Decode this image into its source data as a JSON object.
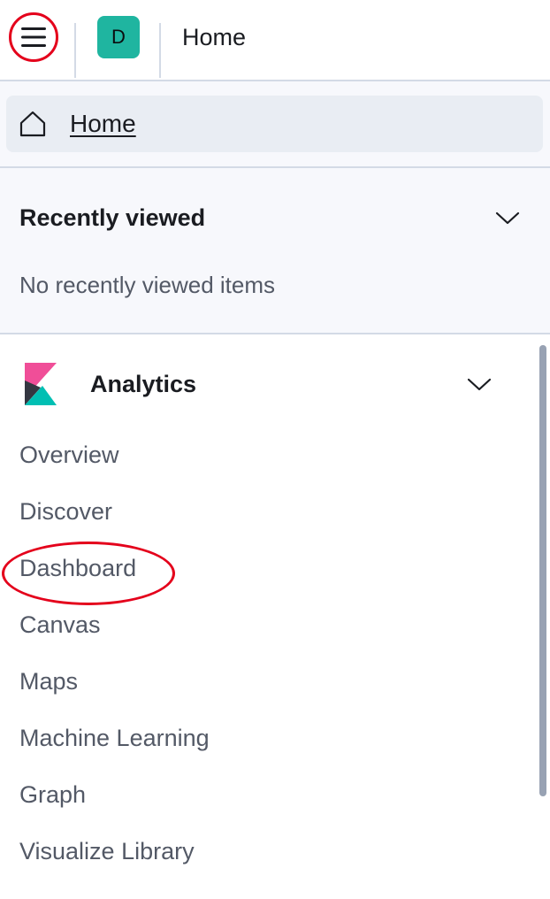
{
  "header": {
    "menu_icon": "hamburger-menu-icon",
    "space_avatar_letter": "D",
    "space_avatar_color": "#1fb5a0",
    "title": "Home"
  },
  "home_link": {
    "icon": "home-icon",
    "label": "Home"
  },
  "recently_viewed": {
    "title": "Recently viewed",
    "chevron_icon": "chevron-down-icon",
    "empty_message": "No recently viewed items"
  },
  "analytics": {
    "logo_icon": "kibana-logo-icon",
    "title": "Analytics",
    "chevron_icon": "chevron-down-icon",
    "items": [
      {
        "label": "Overview"
      },
      {
        "label": "Discover"
      },
      {
        "label": "Dashboard"
      },
      {
        "label": "Canvas"
      },
      {
        "label": "Maps"
      },
      {
        "label": "Machine Learning"
      },
      {
        "label": "Graph"
      },
      {
        "label": "Visualize Library"
      }
    ]
  },
  "colors": {
    "annotation_red": "#e4001b",
    "panel_background": "#f7f8fc",
    "border": "#d3dae6",
    "logo_pink": "#f04e98",
    "logo_teal": "#00bfb3",
    "logo_dark": "#343741"
  }
}
